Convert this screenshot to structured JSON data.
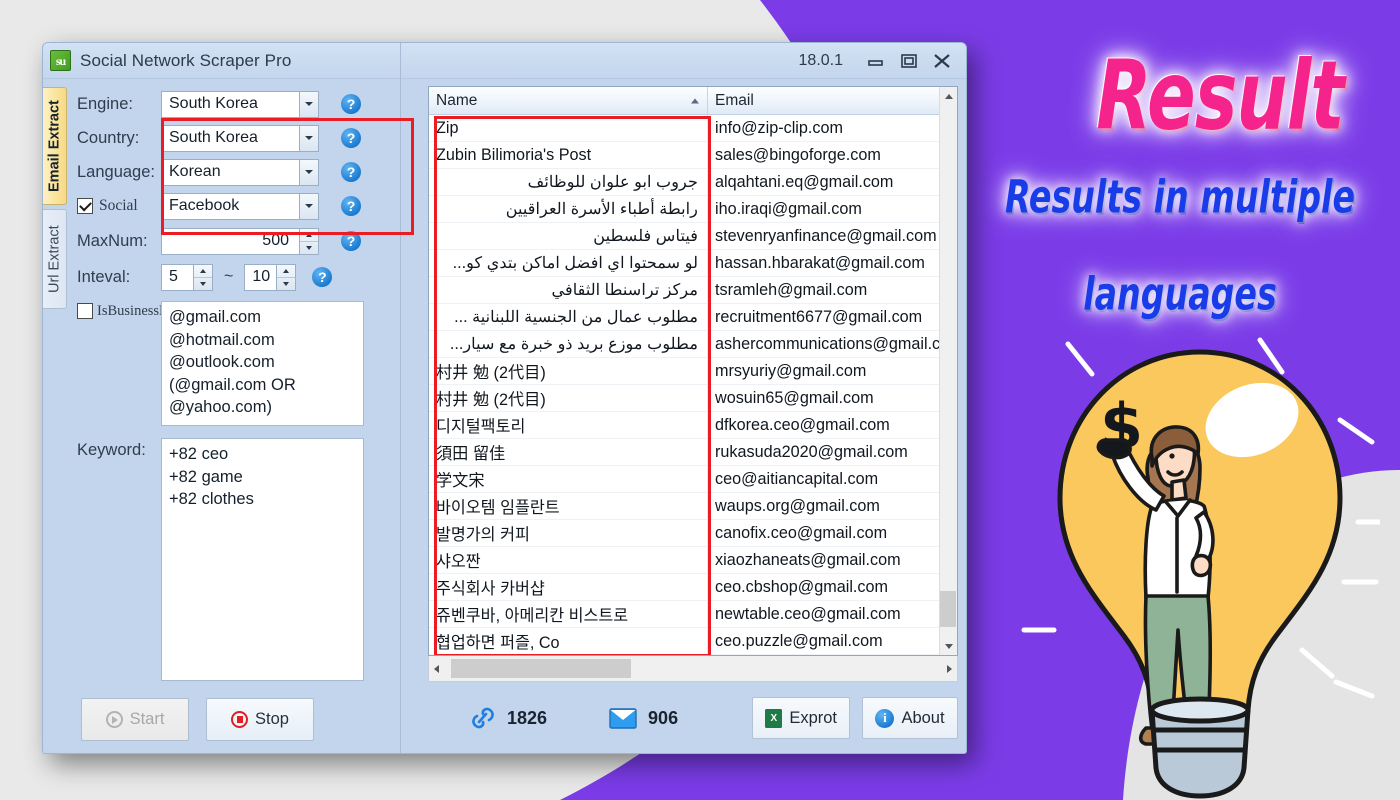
{
  "window": {
    "title": "Social Network Scraper Pro",
    "version": "18.0.1",
    "app_icon": "su-logo-icon",
    "minimize": "minimize-icon",
    "maximize": "maximize-icon",
    "close": "close-icon"
  },
  "vtabs": [
    {
      "label": "Email Extract",
      "active": true
    },
    {
      "label": "Url Extract",
      "active": false
    }
  ],
  "config": {
    "engine_label": "Engine:",
    "engine_value": "South Korea",
    "country_label": "Country:",
    "country_value": "South Korea",
    "language_label": "Language:",
    "language_value": "Korean",
    "social_label": "Social",
    "social_value": "Facebook",
    "social_checked": true,
    "maxnum_label": "MaxNum:",
    "maxnum_value": "500",
    "interval_label": "Inteval:",
    "interval_min": "5",
    "interval_sep": "~",
    "interval_max": "10",
    "isbusiness_label": "IsBusinessDomain",
    "isbusiness_checked": false,
    "domains_text": "@gmail.com\n@hotmail.com\n@outlook.com\n(@gmail.com OR\n@yahoo.com)",
    "keyword_label": "Keyword:",
    "keyword_text": "+82 ceo\n+82 game\n+82 clothes",
    "help_icon": "question-mark-icon"
  },
  "buttons": {
    "start": "Start",
    "start_enabled": false,
    "stop": "Stop",
    "export": "Exprot",
    "about": "About"
  },
  "grid": {
    "columns": [
      "Name",
      "Email"
    ],
    "sort_column": "Name",
    "sort_direction": "asc",
    "rows": [
      {
        "name": "Zip",
        "email": "info@zip-clip.com",
        "rtl": false
      },
      {
        "name": "Zubin Bilimoria's Post",
        "email": "sales@bingoforge.com",
        "rtl": false
      },
      {
        "name": "جروب ابو علوان للوظائف",
        "email": "alqahtani.eq@gmail.com",
        "rtl": true
      },
      {
        "name": "رابطة أطباء الأسرة العراقيين",
        "email": "iho.iraqi@gmail.com",
        "rtl": true
      },
      {
        "name": "فيتاس فلسطين",
        "email": "stevenryanfinance@gmail.com",
        "rtl": true
      },
      {
        "name": "لو سمحتوا اي افضل اماكن بتدي كو...",
        "email": "hassan.hbarakat@gmail.com",
        "rtl": true
      },
      {
        "name": "مركز تراسنطا الثقافي",
        "email": "tsramleh@gmail.com",
        "rtl": true
      },
      {
        "name": "مطلوب عمال من الجنسية اللبنانية ...",
        "email": "recruitment6677@gmail.com",
        "rtl": true
      },
      {
        "name": "مطلوب موزع بريد ذو خبرة مع سيار...",
        "email": "ashercommunications@gmail.cc",
        "rtl": true
      },
      {
        "name": "村井 勉 (2代目)",
        "email": "mrsyuriy@gmail.com",
        "rtl": false
      },
      {
        "name": "村井 勉 (2代目)",
        "email": "wosuin65@gmail.com",
        "rtl": false
      },
      {
        "name": "디지털팩토리",
        "email": "dfkorea.ceo@gmail.com",
        "rtl": false
      },
      {
        "name": "須田 留佳",
        "email": "rukasuda2020@gmail.com",
        "rtl": false
      },
      {
        "name": "学文宋",
        "email": "ceo@aitiancapital.com",
        "rtl": false
      },
      {
        "name": "바이오템 임플란트",
        "email": "waups.org@gmail.com",
        "rtl": false
      },
      {
        "name": "발명가의 커피",
        "email": "canofix.ceo@gmail.com",
        "rtl": false
      },
      {
        "name": "샤오짠",
        "email": "xiaozhaneats@gmail.com",
        "rtl": false
      },
      {
        "name": "주식회사 카버샵",
        "email": "ceo.cbshop@gmail.com",
        "rtl": false
      },
      {
        "name": "쥬벤쿠바, 아메리칸 비스트로",
        "email": "newtable.ceo@gmail.com",
        "rtl": false
      },
      {
        "name": "협업하면 퍼즐, Co",
        "email": "ceo.puzzle@gmail.com",
        "rtl": false
      }
    ]
  },
  "status": {
    "link_icon": "link-icon",
    "link_count": "1826",
    "mail_icon": "envelope-icon",
    "mail_count": "906"
  },
  "promo": {
    "title": "Result",
    "sub1": "Results in multiple",
    "sub2": "languages",
    "title_color": "#f5238c",
    "sub_color": "#1a3ce8",
    "bg_purple": "#7b3ce8"
  }
}
